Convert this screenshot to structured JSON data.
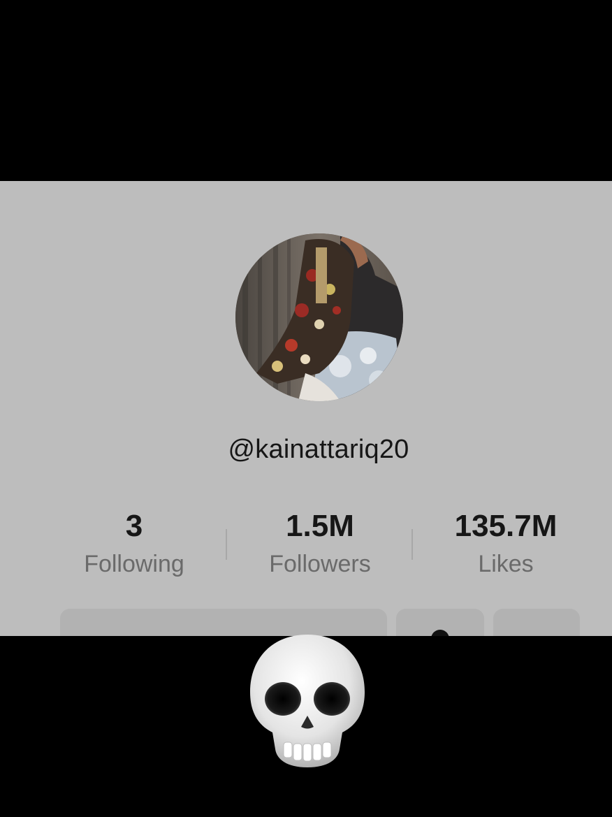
{
  "profile": {
    "username": "@kainattariq20",
    "avatar_icon": "profile-photo"
  },
  "stats": {
    "following": {
      "value": "3",
      "label": "Following"
    },
    "followers": {
      "value": "1.5M",
      "label": "Followers"
    },
    "likes": {
      "value": "135.7M",
      "label": "Likes"
    }
  },
  "overlay": {
    "emoji_icon": "skull-icon"
  },
  "colors": {
    "panel_bg": "#bdbdbd",
    "text_primary": "#161616",
    "text_secondary": "#6a6a6a",
    "letterbox": "#000000"
  }
}
